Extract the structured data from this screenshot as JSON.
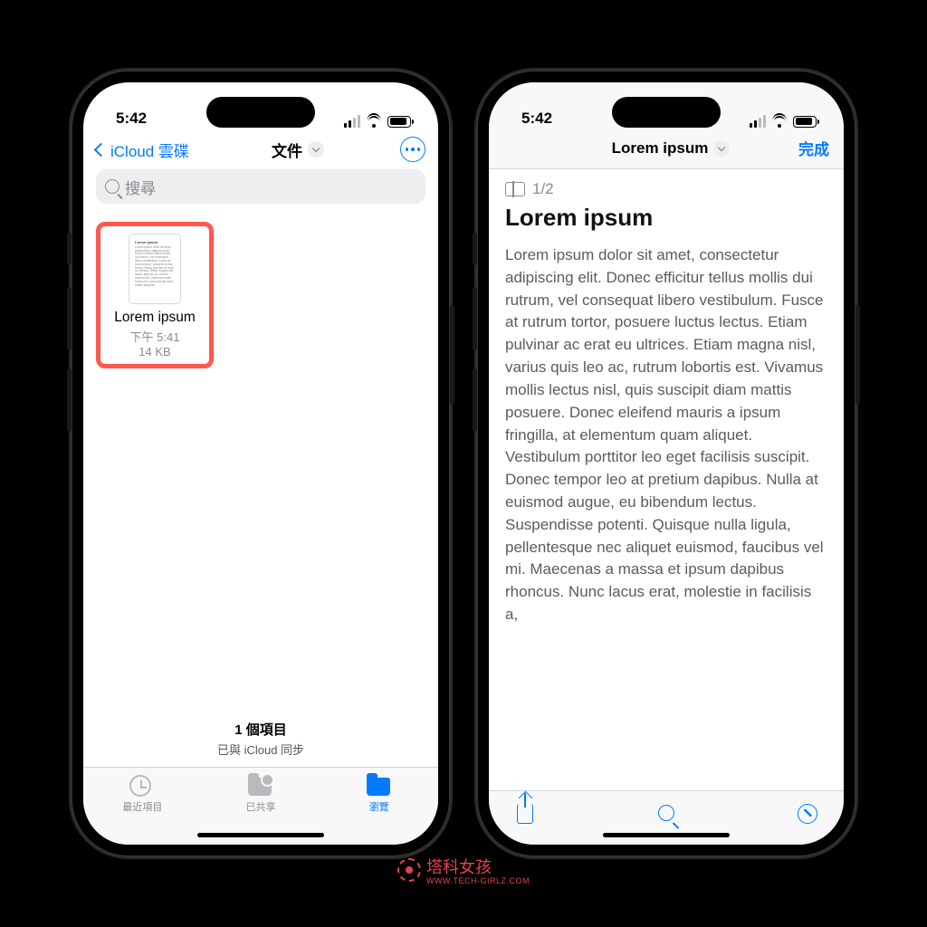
{
  "status": {
    "time": "5:42"
  },
  "left": {
    "nav": {
      "back": "iCloud 雲碟",
      "title": "文件"
    },
    "search": {
      "placeholder": "搜尋"
    },
    "file": {
      "name": "Lorem ipsum",
      "time": "下午 5:41",
      "size": "14 KB",
      "thumb_title": "Lorem ipsum",
      "thumb_text": "Lorem ipsum dolor sit amet, consectetur adipiscing elit. Donec efficitur tellus mollis dui rutrum, vel consequat libero vestibulum. Fusce at rutrum tortor, posuere luctus lectus. Etiam pulvinar ac erat eu ultrices. Etiam magna nisl, varius quis leo ac, rutrum lobortis est. Vivamus mollis lectus nisl, quis suscipit diam mattis posuere."
    },
    "footer": {
      "count": "1 個項目",
      "sync": "已與 iCloud 同步"
    },
    "tabs": {
      "recent": "最近項目",
      "shared": "已共享",
      "browse": "瀏覽"
    }
  },
  "right": {
    "nav": {
      "title": "Lorem ipsum",
      "done": "完成"
    },
    "page_indicator": "1/2",
    "heading": "Lorem ipsum",
    "body": "Lorem ipsum dolor sit amet, consectetur adipiscing elit. Donec efficitur tellus mollis dui rutrum, vel consequat libero vestibulum. Fusce at rutrum tortor, posuere luctus lectus. Etiam pulvinar ac erat eu ultrices. Etiam magna nisl, varius quis leo ac, rutrum lobortis est. Vivamus mollis lectus nisl, quis suscipit diam mattis posuere. Donec eleifend mauris a ipsum fringilla, at elementum quam aliquet. Vestibulum porttitor leo eget facilisis suscipit. Donec tempor leo at pretium dapibus. Nulla at euismod augue, eu bibendum lectus. Suspendisse potenti. Quisque nulla ligula, pellentesque nec aliquet euismod, faucibus vel mi. Maecenas a massa et ipsum dapibus rhoncus. Nunc lacus erat, molestie in facilisis a,"
  },
  "watermark": {
    "name": "塔科女孩",
    "sub": "WWW.TECH-GIRLZ.COM"
  }
}
